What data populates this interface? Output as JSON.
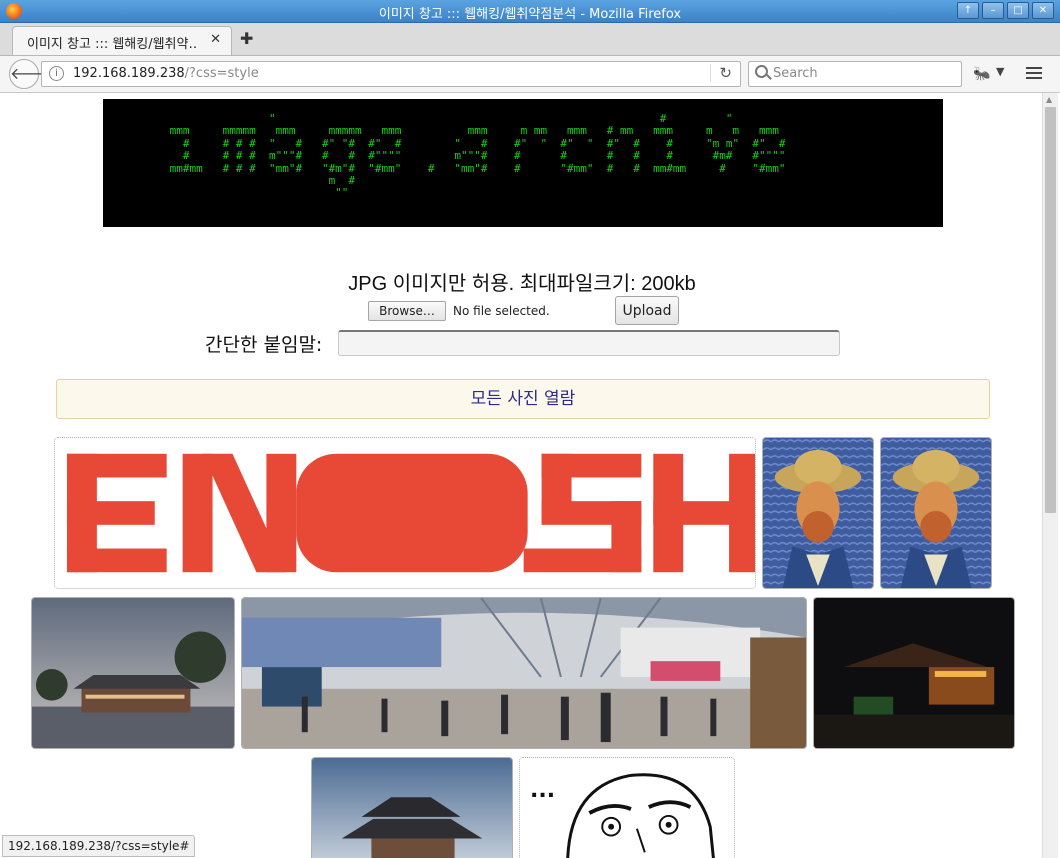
{
  "window": {
    "title": "이미지 창고 ::: 웹해킹/웹취약점분석 - Mozilla Firefox",
    "buttons": [
      "↑",
      "–",
      "□",
      "✕"
    ]
  },
  "tabs": [
    {
      "label": "이미지 창고 ::: 웹해킹/웹취약…",
      "close": "✕"
    }
  ],
  "new_tab_label": "✚",
  "nav": {
    "back_glyph": "🡐",
    "url_host": "192.168.189.238",
    "url_path": "/?css=style",
    "reload_glyph": "↻",
    "search_placeholder": "Search",
    "extension_glyph": "🐜",
    "dropdown_glyph": "▼"
  },
  "page": {
    "banner_ascii": "                \"                                                          #         \"\n mmm     mmmmm   mmm     mmmmm   mmm          mmm     m mm   mmm   # mm   mmm     m   m   mmm\n   #     # # #  \"   #   #\" \"#  #\"  #        \"   #    #\"  \"  #\"  \"  #\"  #    #     \"m m\"  #\"  #\n   #     # # #  m\"\"\"#   #   #  #\"\"\"\"        m\"\"\"#    #      #      #   #    #      #m#   #\"\"\"\"\n mm#mm   # # #  \"mm\"#   \"#m\"#  \"#mm\"    #   \"mm\"#    #      \"#mm\"  #   #  mm#mm     #    \"#mm\"\n                         m  #\n                          \"\"",
    "notice": "JPG 이미지만 허용. 최대파일크기: 200kb",
    "browse_label": "Browse…",
    "file_status": "No file selected.",
    "upload_label": "Upload",
    "caption_label": "간단한 붙임말:",
    "caption_value": "",
    "view_all_label": "모든 사진 열람"
  },
  "gallery": [
    {
      "name": "enough-image",
      "subject": "red pixel text EN▬▬SH"
    },
    {
      "name": "van-gogh-portrait-1",
      "subject": "self-portrait painting"
    },
    {
      "name": "van-gogh-portrait-2",
      "subject": "self-portrait painting"
    },
    {
      "name": "palace-dusk-photo",
      "subject": "traditional building at dusk"
    },
    {
      "name": "station-panorama-photo",
      "subject": "train station hall panorama"
    },
    {
      "name": "night-pavilion-photo",
      "subject": "lit pavilion at night"
    },
    {
      "name": "gate-photo",
      "subject": "traditional gate against sky"
    },
    {
      "name": "rage-face-image",
      "subject": "comic face with ellipsis"
    }
  ],
  "gallery_text": {
    "ellipsis": "..."
  },
  "status_bar_url": "192.168.189.238/?css=style#",
  "colors": {
    "banner_bg": "#000000",
    "banner_text": "#19d019",
    "view_all_bg": "#fcf8ec",
    "view_all_text": "#2b2b8c",
    "enough_red": "#e53a25"
  }
}
